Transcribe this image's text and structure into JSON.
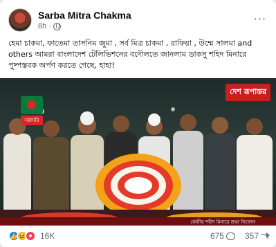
{
  "post": {
    "author": "Sarba Mitra Chakma",
    "time": "8h",
    "dot": "·",
    "caption": "হেমা চাকমা, ফাতেমা তাসনিম জুমা , সর্ব মিত্র চাকমা , রাফিয়া , উম্মে সালমা and others আমরা বাংলাদেশ টেলিভিশনের বদৌলতে জানলাম ডাকসু শহিদ মিনারে পুষ্পস্তবক অর্পণ করতে গেছে, হাহা!"
  },
  "media": {
    "logo_left_tag": "সরাসরি",
    "logo_right": "দেশ রূপান্তর",
    "ticker": "কেন্দ্রীয় শহীদ মিনারে শ্রদ্ধা নিবেদন"
  },
  "footer": {
    "reaction_count": "16K",
    "comments": "675",
    "shares": "357"
  },
  "icons": {
    "like": "like-icon",
    "haha": "haha-icon",
    "love": "love-icon",
    "comment": "comment-icon",
    "share": "share-icon"
  },
  "colors": {
    "like": "#1877f2",
    "haha": "#f7b125",
    "love": "#f33e58",
    "channel_red": "#c81e1e"
  }
}
